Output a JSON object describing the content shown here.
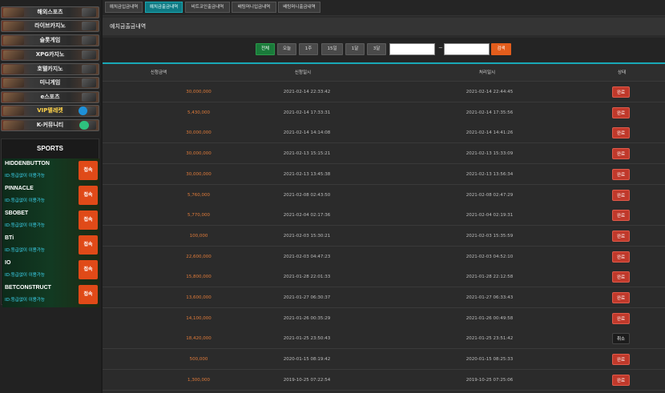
{
  "sidebar": {
    "menu": [
      {
        "label": "해외스포츠"
      },
      {
        "label": "라이브카지노"
      },
      {
        "label": "슬롯게임"
      },
      {
        "label": "XPG카지노"
      },
      {
        "label": "호텔카지노"
      },
      {
        "label": "미니게임"
      },
      {
        "label": "e스포츠"
      },
      {
        "label": "VIP텔레켓"
      },
      {
        "label": "K-커뮤니티"
      }
    ],
    "sports_title": "SPORTS",
    "providers": [
      {
        "name": "HIDDENBUTTON",
        "note": "ID:등급없이 이용가능",
        "button": "접속"
      },
      {
        "name": "PINNACLE",
        "note": "ID:등급없이 이용가능",
        "button": "접속"
      },
      {
        "name": "SBOBET",
        "note": "ID:등급없이 이용가능",
        "button": "접속"
      },
      {
        "name": "BTi",
        "note": "ID:등급없이 이용가능",
        "button": "접속"
      },
      {
        "name": "IO",
        "note": "ID:등급없이 이용가능",
        "button": "접속"
      },
      {
        "name": "BETCONSTRUCT",
        "note": "ID:등급없이 이용가능",
        "button": "접속"
      }
    ]
  },
  "tabs": [
    {
      "label": "예치금입금내역"
    },
    {
      "label": "예치금출금내역"
    },
    {
      "label": "비트코인출금내역"
    },
    {
      "label": "배팅머니입금내역"
    },
    {
      "label": "배팅머니출금내역"
    }
  ],
  "section_title": "예치금출금내역",
  "filter": {
    "buttons": [
      {
        "label": "전체"
      },
      {
        "label": "오늘"
      },
      {
        "label": "1주"
      },
      {
        "label": "15일"
      },
      {
        "label": "1달"
      },
      {
        "label": "3달"
      }
    ],
    "date_separator": "~",
    "search_label": "검색"
  },
  "table": {
    "headers": [
      "신청금액",
      "신청일시",
      "처리일시",
      "상태"
    ],
    "rows": [
      {
        "amount": "30,000,000",
        "requested": "2021-02-14 22:33:42",
        "processed": "2021-02-14 22:44:45",
        "status": "완료"
      },
      {
        "amount": "5,430,000",
        "requested": "2021-02-14 17:33:31",
        "processed": "2021-02-14 17:35:56",
        "status": "완료"
      },
      {
        "amount": "30,000,000",
        "requested": "2021-02-14 14:14:08",
        "processed": "2021-02-14 14:41:26",
        "status": "완료"
      },
      {
        "amount": "30,000,000",
        "requested": "2021-02-13 15:15:21",
        "processed": "2021-02-13 15:33:09",
        "status": "완료"
      },
      {
        "amount": "30,000,000",
        "requested": "2021-02-13 13:45:38",
        "processed": "2021-02-13 13:56:34",
        "status": "완료"
      },
      {
        "amount": "5,760,000",
        "requested": "2021-02-08 02:43:50",
        "processed": "2021-02-08 02:47:29",
        "status": "완료"
      },
      {
        "amount": "5,770,000",
        "requested": "2021-02-04 02:17:36",
        "processed": "2021-02-04 02:19:31",
        "status": "완료"
      },
      {
        "amount": "100,000",
        "requested": "2021-02-03 15:30:21",
        "processed": "2021-02-03 15:35:59",
        "status": "완료"
      },
      {
        "amount": "22,600,000",
        "requested": "2021-02-03 04:47:23",
        "processed": "2021-02-03 04:52:10",
        "status": "완료"
      },
      {
        "amount": "15,800,000",
        "requested": "2021-01-28 22:01:33",
        "processed": "2021-01-28 22:12:58",
        "status": "완료"
      },
      {
        "amount": "13,600,000",
        "requested": "2021-01-27 06:30:37",
        "processed": "2021-01-27 06:33:43",
        "status": "완료"
      },
      {
        "amount": "14,100,000",
        "requested": "2021-01-26 00:35:29",
        "processed": "2021-01-26 00:49:58",
        "status": "완료"
      },
      {
        "amount": "18,420,000",
        "requested": "2021-01-25 23:50:43",
        "processed": "2021-01-25 23:51:42",
        "status": "취소"
      },
      {
        "amount": "500,000",
        "requested": "2020-01-15 08:19:42",
        "processed": "2020-01-15 08:25:33",
        "status": "완료"
      },
      {
        "amount": "1,300,000",
        "requested": "2019-10-25 07:22:54",
        "processed": "2019-10-25 07:25:06",
        "status": "완료"
      }
    ]
  }
}
